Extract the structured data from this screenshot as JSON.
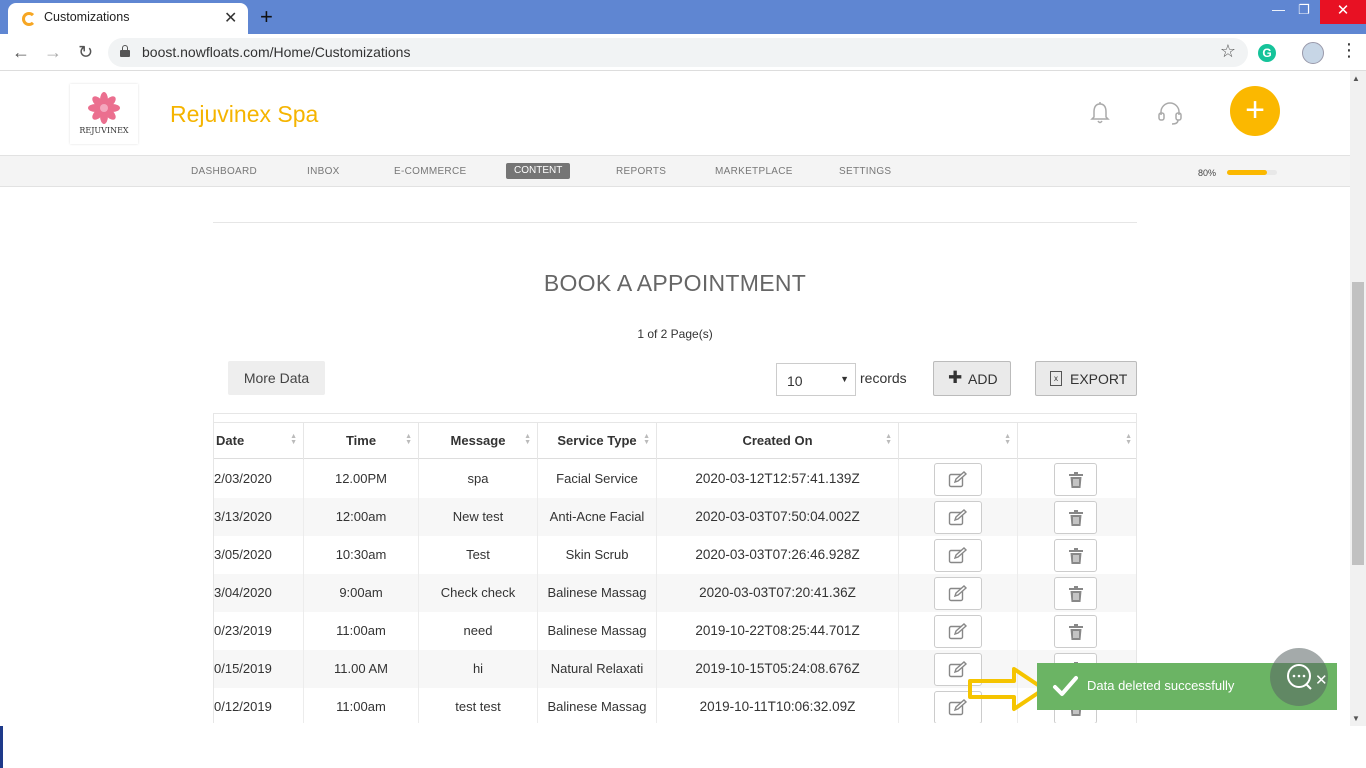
{
  "browser": {
    "tab_title": "Customizations",
    "url": "boost.nowfloats.com/Home/Customizations",
    "extension_letter": "G"
  },
  "header": {
    "logo_text": "REJUVINEX",
    "site_title": "Rejuvinex Spa"
  },
  "nav": {
    "items": [
      "DASHBOARD",
      "INBOX",
      "E-COMMERCE",
      "CONTENT",
      "REPORTS",
      "MARKETPLACE",
      "SETTINGS"
    ],
    "active": "CONTENT",
    "progress_label": "80%",
    "progress_value": 0.8
  },
  "main": {
    "heading": "BOOK A APPOINTMENT",
    "pager": "1 of 2 Page(s)",
    "more_data_label": "More Data",
    "records_select_value": "10",
    "records_label": "records",
    "add_label": "ADD",
    "export_label": "EXPORT"
  },
  "table": {
    "columns": [
      "Date",
      "Time",
      "Message",
      "Service Type",
      "Created On",
      "",
      ""
    ],
    "rows": [
      [
        "2/03/2020",
        "12.00PM",
        "spa",
        "Facial Service",
        "2020-03-12T12:57:41.139Z"
      ],
      [
        "3/13/2020",
        "12:00am",
        "New test",
        "Anti-Acne Facial",
        "2020-03-03T07:50:04.002Z"
      ],
      [
        "3/05/2020",
        "10:30am",
        "Test",
        "Skin Scrub",
        "2020-03-03T07:26:46.928Z"
      ],
      [
        "3/04/2020",
        "9:00am",
        "Check check",
        "Balinese Massag",
        "2020-03-03T07:20:41.36Z"
      ],
      [
        "0/23/2019",
        "11:00am",
        "need",
        "Balinese Massag",
        "2019-10-22T08:25:44.701Z"
      ],
      [
        "0/15/2019",
        "11.00 AM",
        "hi",
        "Natural Relaxati",
        "2019-10-15T05:24:08.676Z"
      ],
      [
        "0/12/2019",
        "11:00am",
        "test test",
        "Balinese Massag",
        "2019-10-11T10:06:32.09Z"
      ]
    ]
  },
  "toast": {
    "message": "Data deleted successfully",
    "close_label": "✕"
  },
  "colors": {
    "brand": "#f5b400",
    "toast": "#6bb464",
    "browser_chrome": "#5f86d2"
  }
}
